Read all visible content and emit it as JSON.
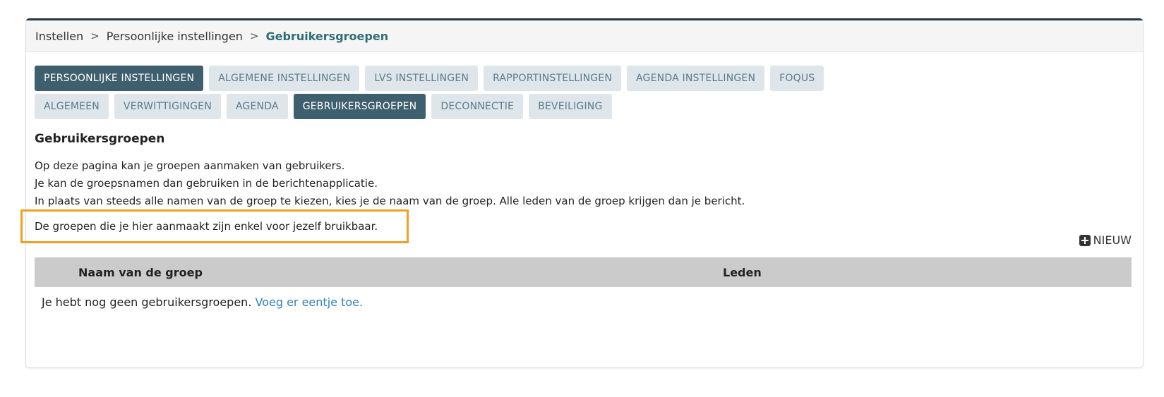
{
  "breadcrumb": {
    "items": [
      "Instellen",
      "Persoonlijke instellingen",
      "Gebruikersgroepen"
    ],
    "separator": ">"
  },
  "tabs_primary": [
    {
      "label": "PERSOONLIJKE INSTELLINGEN",
      "active": true
    },
    {
      "label": "ALGEMENE INSTELLINGEN",
      "active": false
    },
    {
      "label": "LVS INSTELLINGEN",
      "active": false
    },
    {
      "label": "RAPPORTINSTELLINGEN",
      "active": false
    },
    {
      "label": "AGENDA INSTELLINGEN",
      "active": false
    },
    {
      "label": "FOQUS",
      "active": false
    }
  ],
  "tabs_secondary": [
    {
      "label": "ALGEMEEN",
      "active": false
    },
    {
      "label": "VERWITTIGINGEN",
      "active": false
    },
    {
      "label": "AGENDA",
      "active": false
    },
    {
      "label": "GEBRUIKERSGROEPEN",
      "active": true
    },
    {
      "label": "DECONNECTIE",
      "active": false
    },
    {
      "label": "BEVEILIGING",
      "active": false
    }
  ],
  "page": {
    "title": "Gebruikersgroepen",
    "description": [
      "Op deze pagina kan je groepen aanmaken van gebruikers.",
      "Je kan de groepsnamen dan gebruiken in de berichtenapplicatie.",
      "In plaats van steeds alle namen van de groep te kiezen, kies je de naam van de groep. Alle leden van de groep krijgen dan je bericht."
    ],
    "notice": "De groepen die je hier aanmaakt zijn enkel voor jezelf bruikbaar.",
    "new_label": "NIEUW",
    "new_icon": "plus-square-icon"
  },
  "table": {
    "columns": [
      "Naam van de groep",
      "Leden"
    ],
    "empty_text": "Je hebt nog geen gebruikersgroepen.",
    "empty_link": "Voeg er eentje toe."
  },
  "colors": {
    "active_tab": "#3e5f6e",
    "inactive_tab": "#dfe6eb",
    "highlight_border": "#f0a020",
    "link": "#2f7fc0",
    "breadcrumb_current": "#2f6e73"
  }
}
